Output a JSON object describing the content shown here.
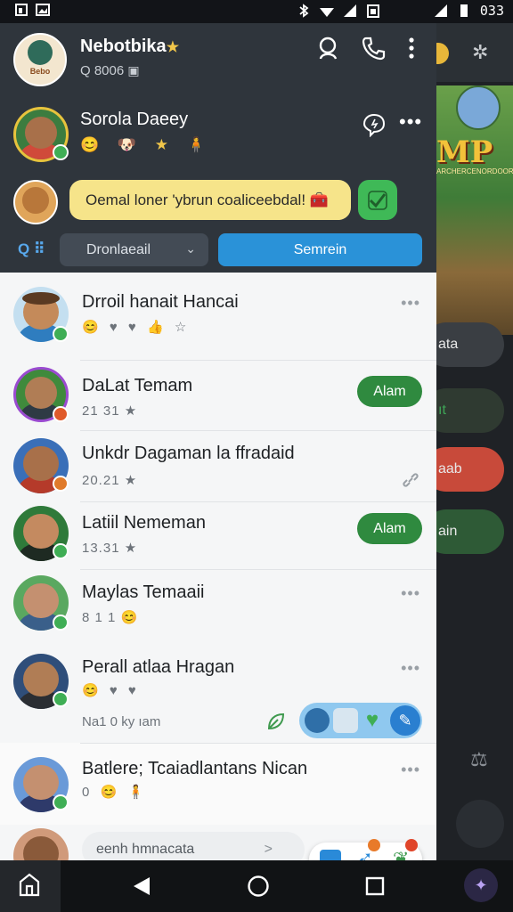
{
  "status_bar": {
    "left_icons": [
      "notification-icon",
      "image-icon"
    ],
    "right_icons": [
      "bluetooth-icon",
      "wifi-icon",
      "signal-icon",
      "battery-icon"
    ],
    "time": "033"
  },
  "header": {
    "profile_name": "Nebotbika",
    "profile_name_icon": "star-icon",
    "profile_sub": "Q 8006",
    "avatar_label": "Bebo",
    "actions": [
      "search-icon",
      "phone-icon",
      "more-vertical-icon"
    ]
  },
  "featured": {
    "name": "Sorola Daeey",
    "emojis": "😊 🐶 ★ 🧍",
    "actions": [
      "chat-bubble-icon",
      "more-horizontal-icon"
    ]
  },
  "message_bubble": {
    "text": "Oemal loner 'ybrun coaliceebdal! 🧰"
  },
  "controls": {
    "filter_label": "Q ⠿",
    "dropdown_value": "Dronlaeail",
    "search_button": "Semrein"
  },
  "contacts": [
    {
      "name": "Drroil hanait Hancai",
      "sub": "😊 ♥ ♥ 👍 ☆",
      "action": "more",
      "more": "•••"
    },
    {
      "name": "DaLat Temam",
      "sub": "21 31 ★",
      "action": "button",
      "button_label": "Alam"
    },
    {
      "name": "Unkdr Dagaman la ffradaid",
      "sub": "20.21 ★",
      "action": "link"
    },
    {
      "name": "Latiil Nememan",
      "sub": "13.31 ★",
      "action": "button",
      "button_label": "Alam"
    },
    {
      "name": "Maylas Temaaii",
      "sub": "8 1 1 😊",
      "action": "more",
      "more": "•••"
    },
    {
      "name": "Perall atlaa Hragan",
      "sub": "😊 ♥ ♥",
      "sub2": "Na1 0 ky ıam",
      "action": "more",
      "more": "•••"
    },
    {
      "name": "Batlere; Tcaiadlantans Nican",
      "sub": "0 😊 🧍",
      "action": "more",
      "more": "•••"
    }
  ],
  "composer": {
    "placeholder": "eenh hmnacata",
    "chevron": ">"
  },
  "fab_group": [
    "chat-icon",
    "photo-icon",
    "heart-icon",
    "pen-icon"
  ],
  "reaction_bar": [
    "message-icon",
    "bird-icon",
    "leaf-icon"
  ],
  "background_app": {
    "title": "MP",
    "subtitle": "ARCHERCENORDOOR",
    "chips": [
      "ata",
      "ıt",
      "aab",
      "ain"
    ]
  },
  "nav_bar": [
    "home-icon",
    "back-icon",
    "home-circle-icon",
    "recents-icon"
  ]
}
